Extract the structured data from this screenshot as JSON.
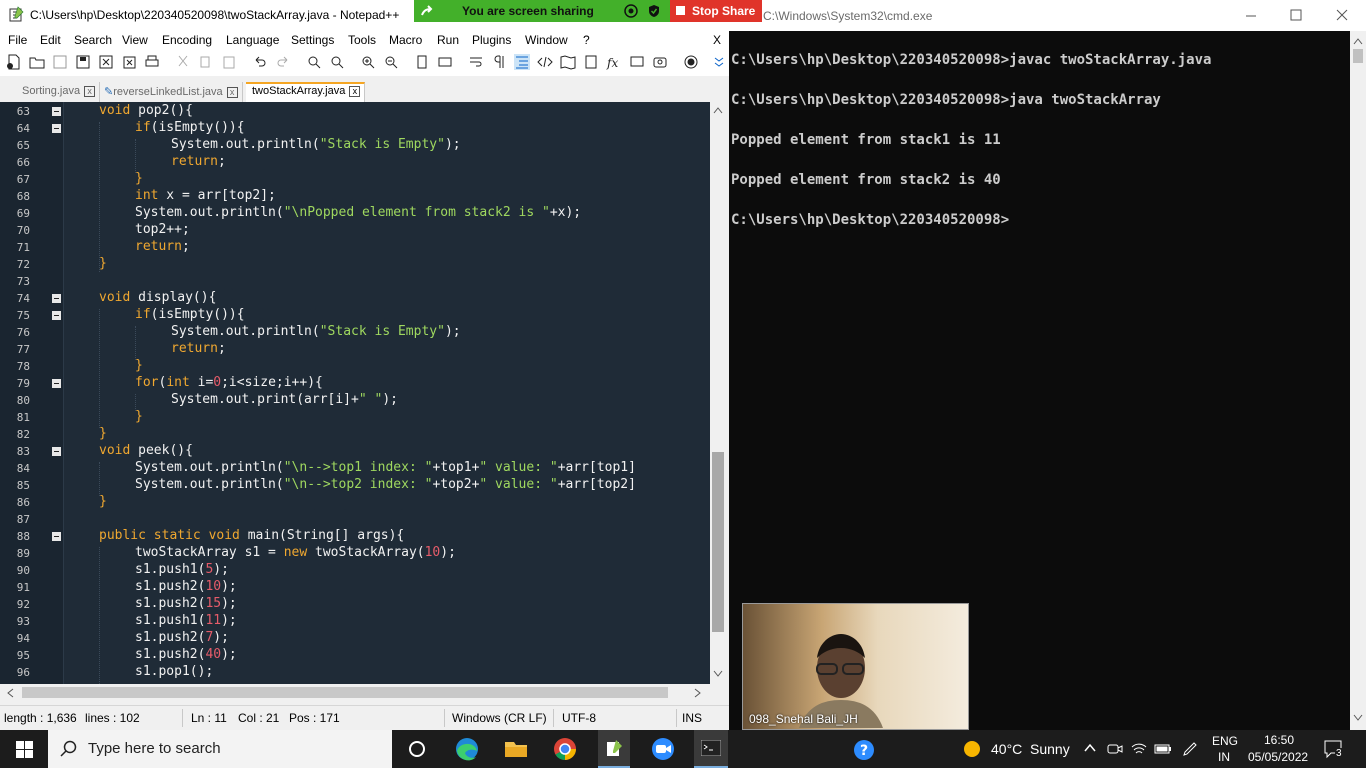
{
  "npp": {
    "title": "C:\\Users\\hp\\Desktop\\220340520098\\twoStackArray.java - Notepad++",
    "menu": [
      "File",
      "Edit",
      "Search",
      "View",
      "Encoding",
      "Language",
      "Settings",
      "Tools",
      "Macro",
      "Run",
      "Plugins",
      "Window",
      "?"
    ],
    "menu_close": "X",
    "tabs": [
      {
        "label": "Sorting.java"
      },
      {
        "label": "reverseLinkedList.java"
      },
      {
        "label": "twoStackArray.java"
      }
    ],
    "line_numbers": [
      "63",
      "64",
      "65",
      "66",
      "67",
      "68",
      "69",
      "70",
      "71",
      "72",
      "73",
      "74",
      "75",
      "76",
      "77",
      "78",
      "79",
      "80",
      "81",
      "82",
      "83",
      "84",
      "85",
      "86",
      "87",
      "88",
      "89",
      "90",
      "91",
      "92",
      "93",
      "94",
      "95",
      "96"
    ],
    "code": {
      "l63a": "void",
      "l63b": " pop2(){",
      "l64a": "if",
      "l64b": "(isEmpty()){",
      "l65a": "System.out.println(",
      "l65b": "\"Stack is Empty\"",
      "l65c": ");",
      "l66a": "return",
      "l66b": ";",
      "l67": "}",
      "l68a": "int",
      "l68b": " x = arr[top2];",
      "l69a": "System.out.println(",
      "l69b": "\"\\nPopped element from stack2 is \"",
      "l69c": "+x);",
      "l70": "top2++;",
      "l71a": "return",
      "l71b": ";",
      "l72": "}",
      "l74a": "void",
      "l74b": " display(){",
      "l75a": "if",
      "l75b": "(isEmpty()){",
      "l76a": "System.out.println(",
      "l76b": "\"Stack is Empty\"",
      "l76c": ");",
      "l77a": "return",
      "l77b": ";",
      "l78": "}",
      "l79a": "for",
      "l79b": "(",
      "l79c": "int",
      "l79d": " i=",
      "l79e": "0",
      "l79f": ";i<size;i++){",
      "l80a": "System.out.print(arr[i]+",
      "l80b": "\" \"",
      "l80c": ");",
      "l81": "}",
      "l82": "}",
      "l83a": "void",
      "l83b": " peek(){",
      "l84a": "System.out.println(",
      "l84b": "\"\\n-->top1 index: \"",
      "l84c": "+top1+",
      "l84d": "\" value: \"",
      "l84e": "+arr[top1]",
      "l85a": "System.out.println(",
      "l85b": "\"\\n-->top2 index: \"",
      "l85c": "+top2+",
      "l85d": "\" value: \"",
      "l85e": "+arr[top2]",
      "l86": "}",
      "l88a": "public static void",
      "l88b": " main(String[] args){",
      "l89a": "twoStackArray s1 = ",
      "l89b": "new",
      "l89c": " twoStackArray(",
      "l89d": "10",
      "l89e": ");",
      "l90a": "s1.push1(",
      "l90b": "5",
      "l90c": ");",
      "l91a": "s1.push2(",
      "l91b": "10",
      "l91c": ");",
      "l92a": "s1.push2(",
      "l92b": "15",
      "l92c": ");",
      "l93a": "s1.push1(",
      "l93b": "11",
      "l93c": ");",
      "l94a": "s1.push2(",
      "l94b": "7",
      "l94c": ");",
      "l95a": "s1.push2(",
      "l95b": "40",
      "l95c": ");",
      "l96": "s1.pop1();"
    },
    "status": {
      "length": "length : 1,636",
      "lines": "lines : 102",
      "ln": "Ln : 11",
      "col": "Col : 21",
      "pos": "Pos : 171",
      "eol": "Windows (CR LF)",
      "encoding": "UTF-8",
      "mode": "INS"
    }
  },
  "share": {
    "message": "You are screen sharing",
    "stop_label": "Stop Share"
  },
  "cmd": {
    "title": "C:\\Windows\\System32\\cmd.exe",
    "lines": [
      "C:\\Users\\hp\\Desktop\\220340520098>javac twoStackArray.java",
      "C:\\Users\\hp\\Desktop\\220340520098>java twoStackArray",
      "Popped element from stack1 is 11",
      "Popped element from stack2 is 40",
      "C:\\Users\\hp\\Desktop\\220340520098>"
    ]
  },
  "webcam": {
    "participant_name": "098_Snehal Bali_JH"
  },
  "taskbar": {
    "search_placeholder": "Type here to search",
    "weather_temp": "40°C",
    "weather_text": "Sunny",
    "lang_top": "ENG",
    "lang_bottom": "IN",
    "time": "16:50",
    "date": "05/05/2022",
    "notification_count": "3"
  },
  "colors": {
    "editor_bg": "#1f2b37",
    "keyword": "#f0a830",
    "string": "#9fd85f",
    "number": "#e65c6a",
    "share_green": "#43b02a",
    "stop_red": "#e0342a"
  }
}
